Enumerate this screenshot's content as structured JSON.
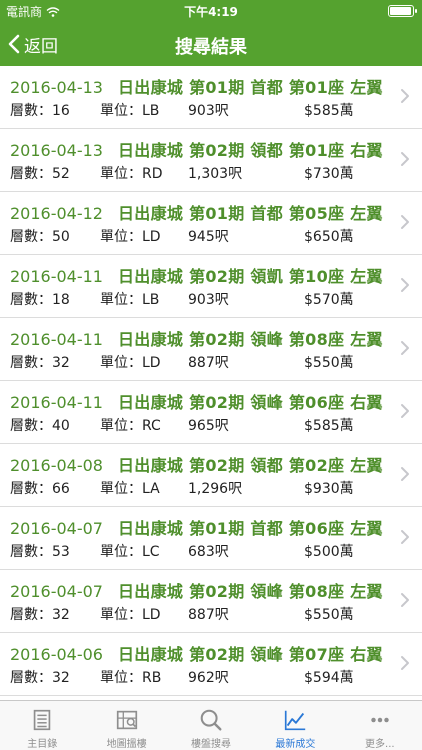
{
  "status_bar": {
    "carrier": "電訊商",
    "time": "下午4:19"
  },
  "nav": {
    "back_label": "返回",
    "title": "搜尋結果"
  },
  "labels": {
    "floor": "層數：",
    "unit": "單位：",
    "area_unit": "呎",
    "price_prefix": "$",
    "price_suffix": "萬"
  },
  "rows": [
    {
      "date": "2016-04-13",
      "desc": "日出康城 第01期 首都 第01座 左翼",
      "floor": "16",
      "unit": "LB",
      "area": "903",
      "price": "585"
    },
    {
      "date": "2016-04-13",
      "desc": "日出康城 第02期 領都 第01座 右翼",
      "floor": "52",
      "unit": "RD",
      "area": "1,303",
      "price": "730"
    },
    {
      "date": "2016-04-12",
      "desc": "日出康城 第01期 首都 第05座 左翼",
      "floor": "50",
      "unit": "LD",
      "area": "945",
      "price": "650"
    },
    {
      "date": "2016-04-11",
      "desc": "日出康城 第02期 領凱 第10座 左翼",
      "floor": "18",
      "unit": "LB",
      "area": "903",
      "price": "570"
    },
    {
      "date": "2016-04-11",
      "desc": "日出康城 第02期 領峰 第08座 左翼",
      "floor": "32",
      "unit": "LD",
      "area": "887",
      "price": "550"
    },
    {
      "date": "2016-04-11",
      "desc": "日出康城 第02期 領峰 第06座 右翼",
      "floor": "40",
      "unit": "RC",
      "area": "965",
      "price": "585"
    },
    {
      "date": "2016-04-08",
      "desc": "日出康城 第02期 領都 第02座 左翼",
      "floor": "66",
      "unit": "LA",
      "area": "1,296",
      "price": "930"
    },
    {
      "date": "2016-04-07",
      "desc": "日出康城 第01期 首都 第06座 左翼",
      "floor": "53",
      "unit": "LC",
      "area": "683",
      "price": "500"
    },
    {
      "date": "2016-04-07",
      "desc": "日出康城 第02期 領峰 第08座 左翼",
      "floor": "32",
      "unit": "LD",
      "area": "887",
      "price": "550"
    },
    {
      "date": "2016-04-06",
      "desc": "日出康城 第02期 領峰 第07座 右翼",
      "floor": "32",
      "unit": "RB",
      "area": "962",
      "price": "594"
    }
  ],
  "tabs": [
    {
      "label": "主目錄",
      "icon": "list-icon"
    },
    {
      "label": "地圖搵樓",
      "icon": "map-icon"
    },
    {
      "label": "樓盤搜尋",
      "icon": "search-icon"
    },
    {
      "label": "最新成交",
      "icon": "chart-icon",
      "active": true
    },
    {
      "label": "更多...",
      "icon": "more-icon"
    }
  ],
  "colors": {
    "brand_green": "#55a22f",
    "row_title_green": "#4f8f2c",
    "active_tab_blue": "#2a78d6"
  }
}
